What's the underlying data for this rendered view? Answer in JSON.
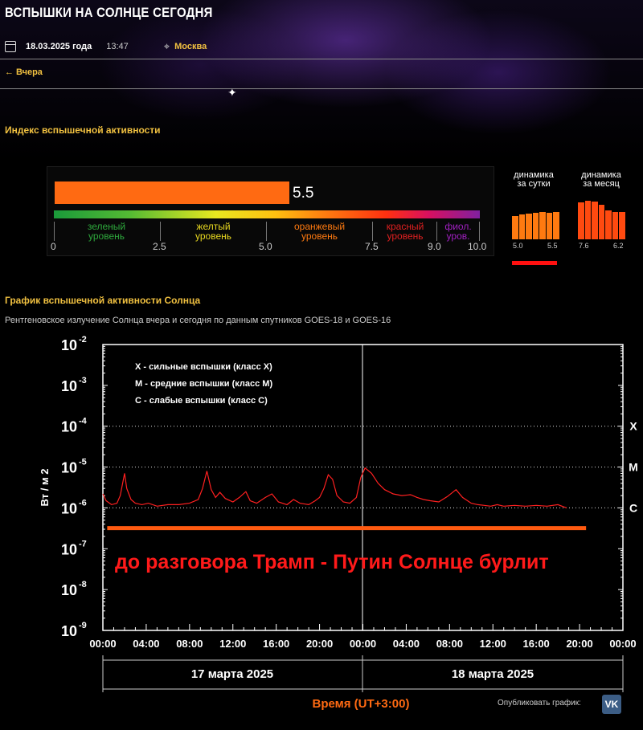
{
  "header": {
    "title": "ВСПЫШКИ НА СОЛНЦЕ СЕГОДНЯ",
    "date": "18.03.2025 года",
    "time": "13:47",
    "city": "Москва",
    "back_link": "← Вчера"
  },
  "index_section": {
    "title": "Индекс вспышечной активности",
    "value": 5.5,
    "value_label": "5.5",
    "scale_max": 10,
    "levels": [
      {
        "line1": "зеленый",
        "line2": "уровень",
        "color": "#2ea83c"
      },
      {
        "line1": "желтый",
        "line2": "уровень",
        "color": "#e8d820"
      },
      {
        "line1": "оранжевый",
        "line2": "уровень",
        "color": "#ff7a10"
      },
      {
        "line1": "красный",
        "line2": "уровень",
        "color": "#e02020"
      },
      {
        "line1": "фиол.",
        "line2": "уров.",
        "color": "#a020c0"
      }
    ],
    "ticks": [
      "0",
      "2.5",
      "5.0",
      "7.5",
      "9.0",
      "10.0"
    ],
    "bar_color": "#ff6a12",
    "day_dynamics": {
      "title1": "динамика",
      "title2": "за сутки",
      "from": "5.0",
      "to": "5.5",
      "bars": [
        5.0,
        5.2,
        5.3,
        5.4,
        5.5,
        5.4,
        5.5
      ],
      "color": "#ff7a10"
    },
    "month_dynamics": {
      "title1": "динамика",
      "title2": "за месяц",
      "from": "7.6",
      "to": "6.2",
      "bars": [
        7.6,
        7.8,
        7.7,
        7.2,
        6.5,
        6.3,
        6.2
      ],
      "color": "#ff4a10"
    }
  },
  "chart_section": {
    "title": "График вспышечной активности Солнца",
    "subtitle": "Рентгеновское излучение Солнца вчера и сегодня по данным спутников GOES-18 и GOES-16",
    "annotation": "до разговора Трамп - Путин Солнце бурлит",
    "publish_label": "Опубликовать график:",
    "vk_label": "VK",
    "accent": "#ff6a12",
    "annotation_color": "#ff1a1a"
  },
  "chart_data": {
    "type": "line",
    "y_scale": "log",
    "ylim": [
      1e-09,
      0.01
    ],
    "xlim": [
      0,
      48
    ],
    "ylabel": "Вт / м 2",
    "xlabel": "Время (UT+3:00)",
    "y_tick_labels": [
      {
        "base": "10",
        "exp": "-2",
        "value": 0.01
      },
      {
        "base": "10",
        "exp": "-3",
        "value": 0.001
      },
      {
        "base": "10",
        "exp": "-4",
        "value": 0.0001
      },
      {
        "base": "10",
        "exp": "-5",
        "value": 1e-05
      },
      {
        "base": "10",
        "exp": "-6",
        "value": 1e-06
      },
      {
        "base": "10",
        "exp": "-7",
        "value": 1e-07
      },
      {
        "base": "10",
        "exp": "-8",
        "value": 1e-08
      },
      {
        "base": "10",
        "exp": "-9",
        "value": 1e-09
      }
    ],
    "x_tick_labels": [
      "00:00",
      "04:00",
      "08:00",
      "12:00",
      "16:00",
      "20:00",
      "00:00",
      "04:00",
      "08:00",
      "12:00",
      "16:00",
      "20:00",
      "00:00"
    ],
    "day_labels": [
      "17 марта 2025",
      "18 марта 2025"
    ],
    "class_levels": [
      {
        "label": "X",
        "value": 0.0001
      },
      {
        "label": "M",
        "value": 1e-05
      },
      {
        "label": "C",
        "value": 1e-06
      }
    ],
    "legend": [
      "X - сильные вспышки (класс X)",
      "M - средние вспышки (класс M)",
      "C - слабые вспышки (класс C)"
    ],
    "threshold_value": 3.2e-07,
    "series": [
      {
        "color": "#ff2020",
        "x": [
          0,
          0.3,
          0.8,
          1.3,
          1.6,
          2.0,
          2.2,
          2.6,
          3.0,
          3.6,
          4.2,
          5.0,
          6.0,
          7.0,
          8.0,
          8.8,
          9.2,
          9.6,
          10.0,
          10.4,
          10.8,
          11.3,
          12.0,
          12.6,
          13.2,
          13.6,
          14.2,
          15.0,
          15.6,
          16.2,
          17.0,
          17.6,
          18.2,
          19.0,
          19.6,
          20.0,
          20.4,
          20.8,
          21.2,
          21.6,
          22.2,
          22.8,
          23.4,
          23.8,
          24.2,
          24.8,
          25.4,
          26.0,
          26.8,
          27.6,
          28.4,
          29.0,
          29.6,
          30.2,
          31.0,
          31.8,
          32.6,
          33.2,
          34.0,
          34.6,
          35.2,
          35.8,
          36.4,
          37.0,
          38.0,
          39.0,
          40.0,
          41.0,
          42.0,
          42.8
        ],
        "y": [
          2.2e-06,
          1.5e-06,
          1.2e-06,
          1.3e-06,
          2e-06,
          7e-06,
          3e-06,
          1.6e-06,
          1.3e-06,
          1.2e-06,
          1.3e-06,
          1.1e-06,
          1.2e-06,
          1.2e-06,
          1.3e-06,
          1.6e-06,
          3e-06,
          8e-06,
          2.8e-06,
          1.8e-06,
          2.4e-06,
          1.7e-06,
          1.4e-06,
          1.8e-06,
          2.5e-06,
          1.5e-06,
          1.3e-06,
          1.8e-06,
          2.2e-06,
          1.4e-06,
          1.2e-06,
          1.6e-06,
          1.3e-06,
          1.2e-06,
          1.5e-06,
          1.8e-06,
          3e-06,
          6.5e-06,
          5e-06,
          2e-06,
          1.4e-06,
          1.3e-06,
          1.8e-06,
          5.5e-06,
          9.5e-06,
          7e-06,
          4e-06,
          2.8e-06,
          2.2e-06,
          2e-06,
          2.1e-06,
          1.8e-06,
          1.6e-06,
          1.5e-06,
          1.4e-06,
          1.9e-06,
          2.8e-06,
          1.8e-06,
          1.3e-06,
          1.2e-06,
          1.15e-06,
          1.1e-06,
          1.2e-06,
          1.1e-06,
          1.15e-06,
          1.1e-06,
          1.15e-06,
          1.1e-06,
          1.2e-06,
          1e-06
        ]
      }
    ]
  }
}
